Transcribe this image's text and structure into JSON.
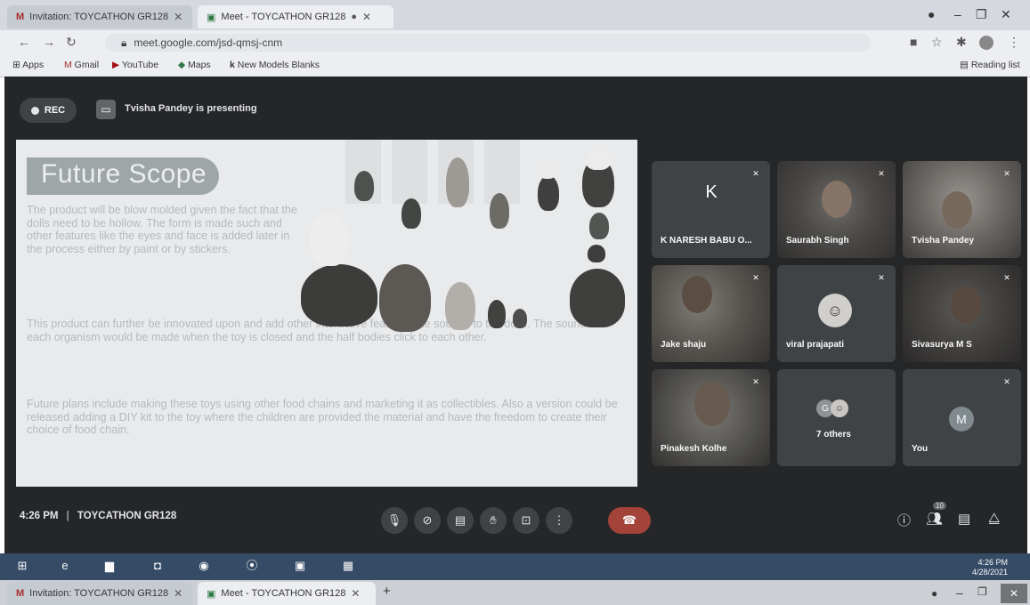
{
  "browser": {
    "tabs": [
      {
        "label": "Invitation: TOYCATHON GR128",
        "active": false
      },
      {
        "label": "Meet - TOYCATHON GR128",
        "active": true
      }
    ],
    "url": "meet.google.com/jsd-qmsj-cnm",
    "bookmarks": [
      "Apps",
      "Gmail",
      "YouTube",
      "Maps",
      "New Models Blanks"
    ],
    "reading_list": "Reading list"
  },
  "meet": {
    "rec_label": "REC",
    "presenting_text": "Tvisha Pandey is presenting",
    "slide": {
      "title": "Future Scope",
      "paragraphs": [
        "The product will be blow molded given the fact that the dolls need to be hollow. The form is made such and other features like the eyes and face is added later in the process either by paint or by stickers.",
        "This product can further be innovated upon and add other interactive features like sounds to the dolls. The sounds for each organism would be made when the toy is closed and the half bodies click to each other.",
        "Future plans include making these toys using other food chains and marketing it as collectibles. Also a version could be released adding a DIY kit to the toy where the children are provided the material and have the freedom to create their choice of food chain."
      ]
    },
    "participants": [
      {
        "name": "K NARESH BABU O...",
        "initial": "K",
        "type": "initial"
      },
      {
        "name": "Saurabh Singh",
        "type": "video"
      },
      {
        "name": "Tvisha Pandey",
        "type": "video"
      },
      {
        "name": "Jake shaju",
        "type": "video"
      },
      {
        "name": "viral prajapati",
        "type": "avatar"
      },
      {
        "name": "Sivasurya M S",
        "type": "video"
      },
      {
        "name": "Pinakesh Kolhe",
        "type": "video"
      },
      {
        "name": "7 others",
        "type": "others"
      },
      {
        "name": "You",
        "initial": "M",
        "type": "initial"
      }
    ],
    "time": "4:26 PM",
    "separator": "|",
    "meeting_name": "TOYCATHON GR128",
    "people_count": "10",
    "colors": {
      "end_call": "#c0392b",
      "meet_bg": "#202124",
      "tile_bg": "#3c4043",
      "avatar_m": "#7e8b91"
    }
  },
  "taskbar": {
    "clock": "4:26 PM",
    "date": "4/28/2021"
  }
}
